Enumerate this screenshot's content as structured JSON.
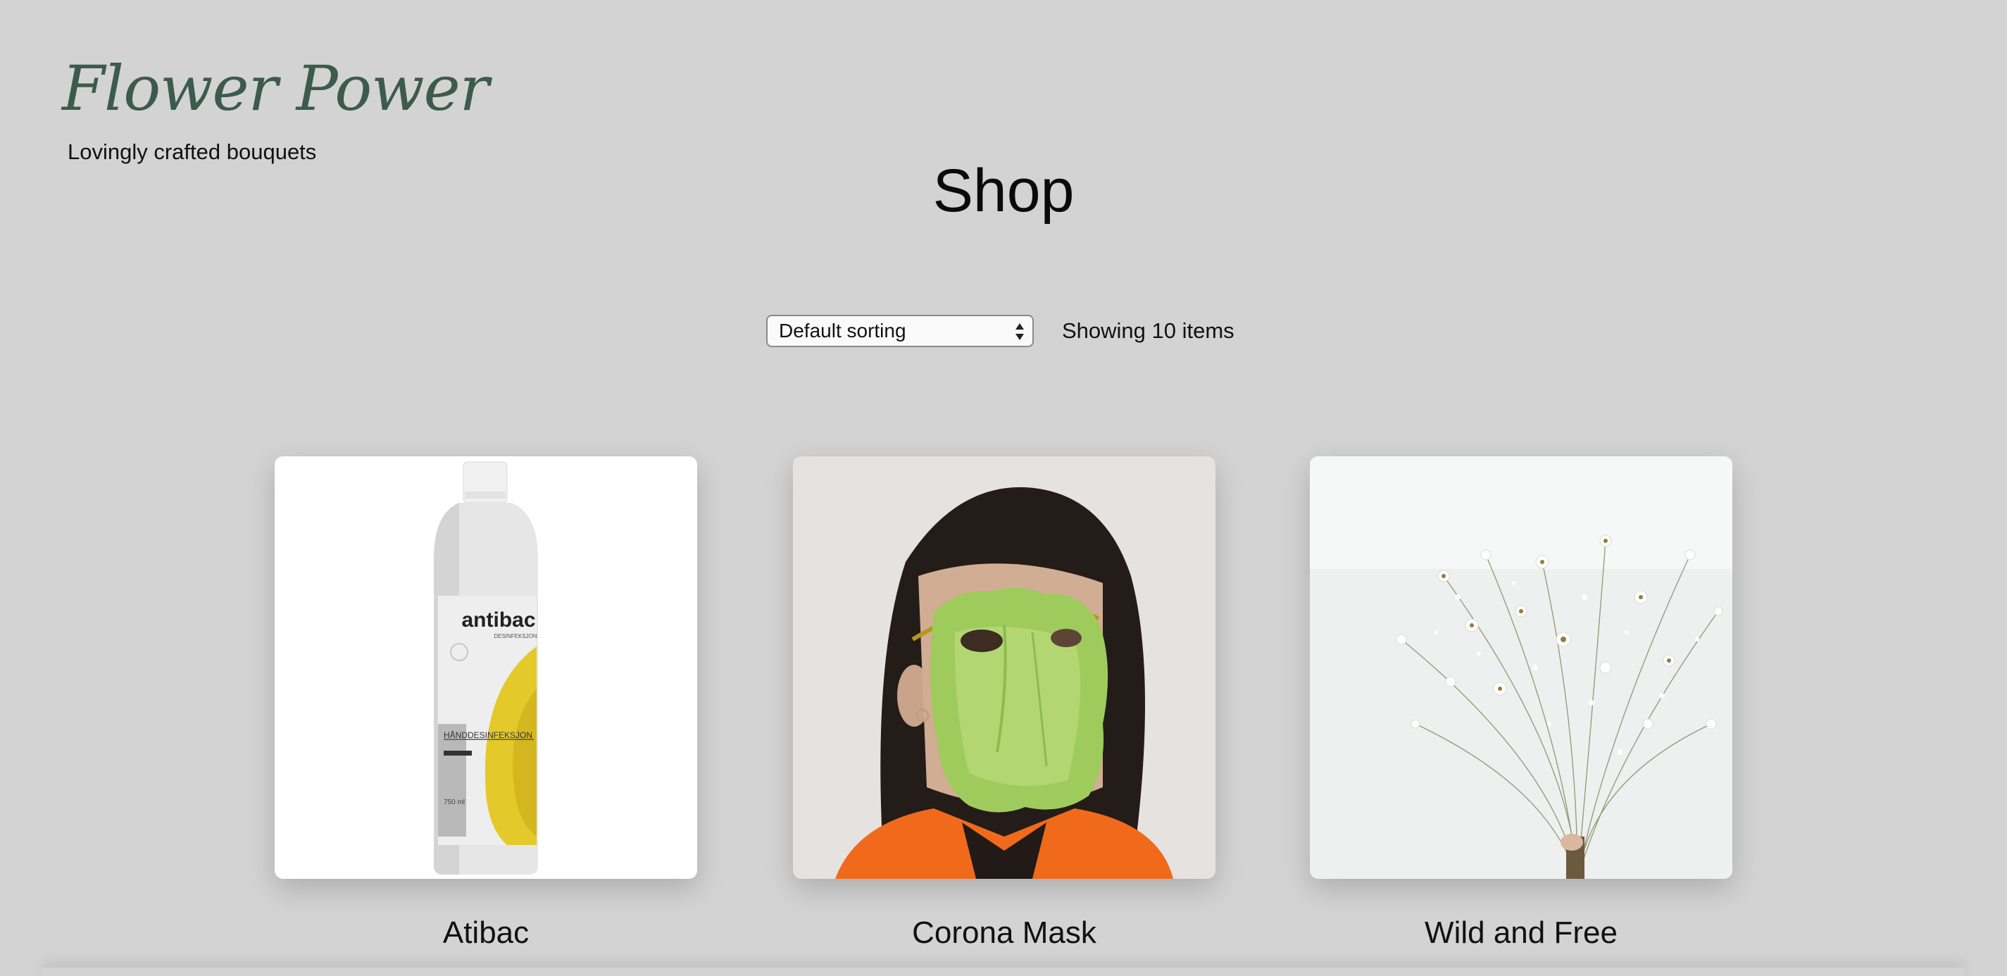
{
  "brand": {
    "name": "Flower Power",
    "tagline": "Lovingly crafted bouquets",
    "logo_icon": "flower-wreath-icon",
    "accent_color": "#3d5a4e"
  },
  "page": {
    "title": "Shop"
  },
  "controls": {
    "sort_selected": "Default sorting",
    "sort_icon": "select-arrows-icon",
    "item_count": "Showing 10 items"
  },
  "products": [
    {
      "name": "Atibac",
      "image": "antibac-bottle"
    },
    {
      "name": "Corona Mask",
      "image": "lettuce-mask-portrait"
    },
    {
      "name": "Wild and Free",
      "image": "wildflower-bouquet"
    }
  ]
}
